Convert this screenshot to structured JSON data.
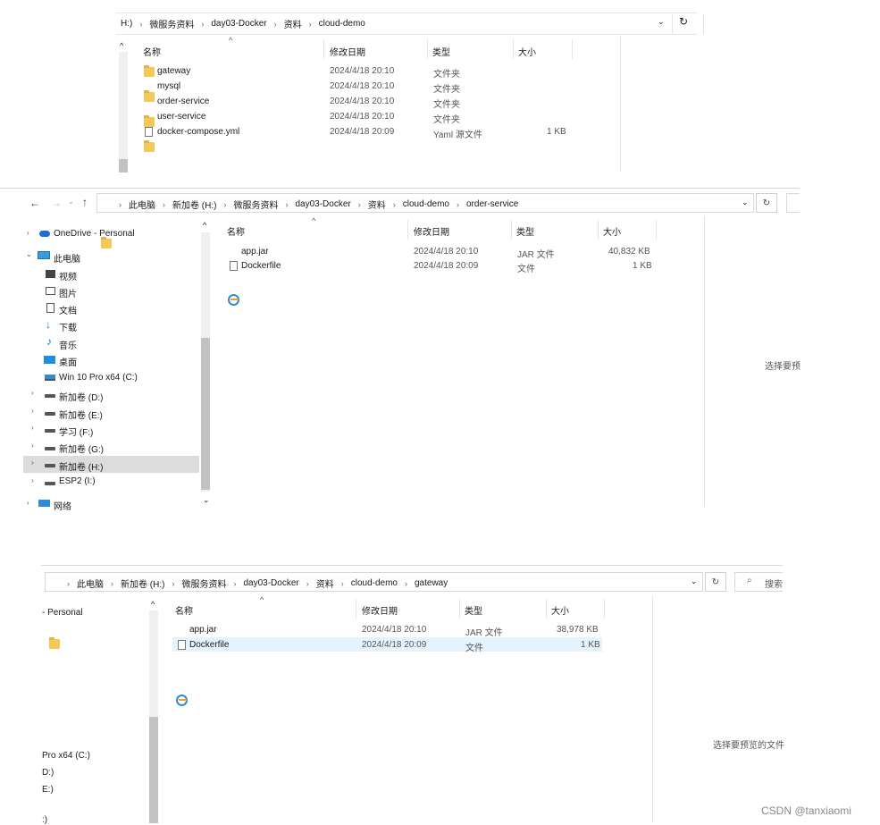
{
  "window1": {
    "breadcrumb": [
      "H:)",
      "微服务资料",
      "day03-Docker",
      "资料",
      "cloud-demo"
    ],
    "columns": [
      "名称",
      "修改日期",
      "类型",
      "大小"
    ],
    "rows": [
      {
        "name": "gateway",
        "date": "2024/4/18 20:10",
        "type": "文件夹",
        "size": "",
        "icon": "folder-icon"
      },
      {
        "name": "mysql",
        "date": "2024/4/18 20:10",
        "type": "文件夹",
        "size": "",
        "icon": "folder-icon"
      },
      {
        "name": "order-service",
        "date": "2024/4/18 20:10",
        "type": "文件夹",
        "size": "",
        "icon": "folder-icon"
      },
      {
        "name": "user-service",
        "date": "2024/4/18 20:10",
        "type": "文件夹",
        "size": "",
        "icon": "folder-icon"
      },
      {
        "name": "docker-compose.yml",
        "date": "2024/4/18 20:09",
        "type": "Yaml 源文件",
        "size": "1 KB",
        "icon": "yml-file-icon"
      }
    ]
  },
  "window2": {
    "breadcrumb": [
      "此电脑",
      "新加卷 (H:)",
      "微服务资料",
      "day03-Docker",
      "资料",
      "cloud-demo",
      "order-service"
    ],
    "columns": [
      "名称",
      "修改日期",
      "类型",
      "大小"
    ],
    "rows": [
      {
        "name": "app.jar",
        "date": "2024/4/18 20:10",
        "type": "JAR 文件",
        "size": "40,832 KB",
        "icon": "jar-icon"
      },
      {
        "name": "Dockerfile",
        "date": "2024/4/18 20:09",
        "type": "文件",
        "size": "1 KB",
        "icon": "file-icon"
      }
    ],
    "nav": {
      "onedrive": "OneDrive - Personal",
      "thispc": "此电脑",
      "items": [
        "视频",
        "图片",
        "文档",
        "下载",
        "音乐",
        "桌面",
        "Win 10 Pro x64 (C:)",
        "新加卷 (D:)",
        "新加卷 (E:)",
        "学习 (F:)",
        "新加卷 (G:)",
        "新加卷 (H:)",
        "ESP2 (I:)"
      ],
      "network": "网络"
    },
    "preview_text": "选择要预"
  },
  "window3": {
    "breadcrumb": [
      "此电脑",
      "新加卷 (H:)",
      "微服务资料",
      "day03-Docker",
      "资料",
      "cloud-demo",
      "gateway"
    ],
    "columns": [
      "名称",
      "修改日期",
      "类型",
      "大小"
    ],
    "rows": [
      {
        "name": "app.jar",
        "date": "2024/4/18 20:10",
        "type": "JAR 文件",
        "size": "38,978 KB",
        "icon": "jar-icon"
      },
      {
        "name": "Dockerfile",
        "date": "2024/4/18 20:09",
        "type": "文件",
        "size": "1 KB",
        "icon": "file-icon"
      }
    ],
    "nav": {
      "onedrive": "- Personal",
      "items": [
        "Pro x64 (C:)",
        "D:)",
        "E:)",
        ":)"
      ]
    },
    "search_placeholder": "搜索",
    "preview_text": "选择要预览的文件"
  },
  "watermark": "CSDN @tanxiaomi"
}
